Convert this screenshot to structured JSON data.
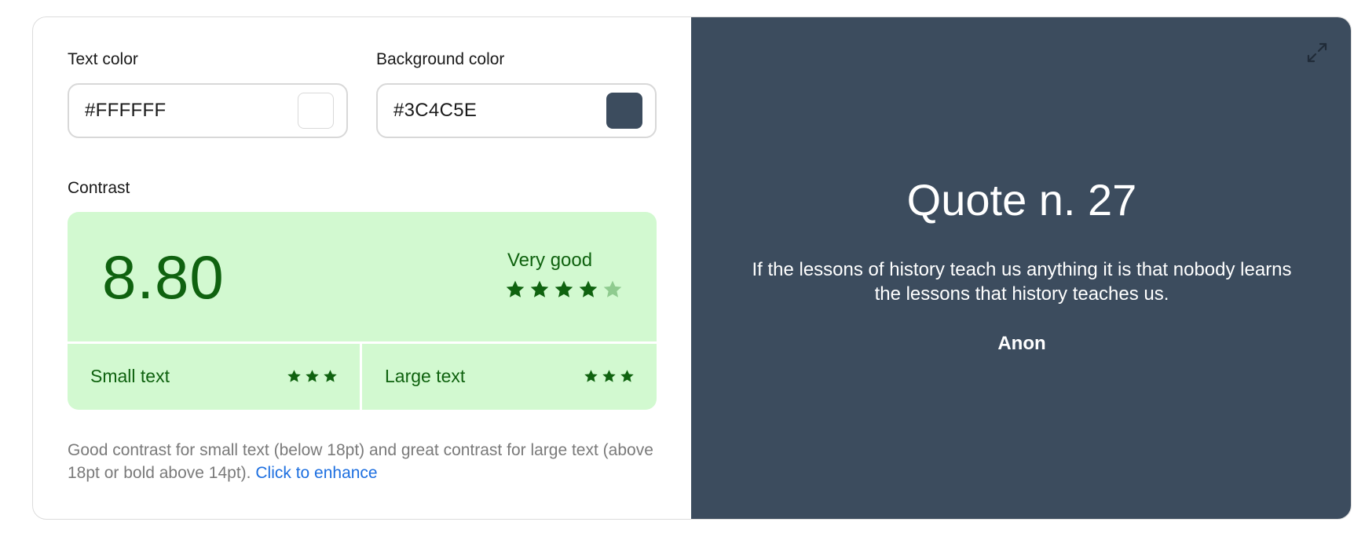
{
  "text_color": {
    "label": "Text color",
    "value": "#FFFFFF",
    "swatch": "#FFFFFF"
  },
  "background_color": {
    "label": "Background color",
    "value": "#3C4C5E",
    "swatch": "#3C4C5E"
  },
  "contrast": {
    "label": "Contrast",
    "ratio": "8.80",
    "rating": "Very good",
    "stars": 4,
    "stars_max": 5,
    "small_text": {
      "label": "Small text",
      "stars": 3
    },
    "large_text": {
      "label": "Large text",
      "stars": 3
    },
    "colors": {
      "panel": "#D2F9D0",
      "accent": "#0F620F",
      "dim_star": "#8FCB8F"
    }
  },
  "description": {
    "text": "Good contrast for small text (below 18pt) and great contrast for large text (above 18pt or bold above 14pt).",
    "link": "Click to enhance"
  },
  "preview": {
    "icon": "expand-icon",
    "title": "Quote n. 27",
    "quote": "If the lessons of history teach us anything it is that nobody learns the lessons that history teaches us.",
    "author": "Anon"
  }
}
